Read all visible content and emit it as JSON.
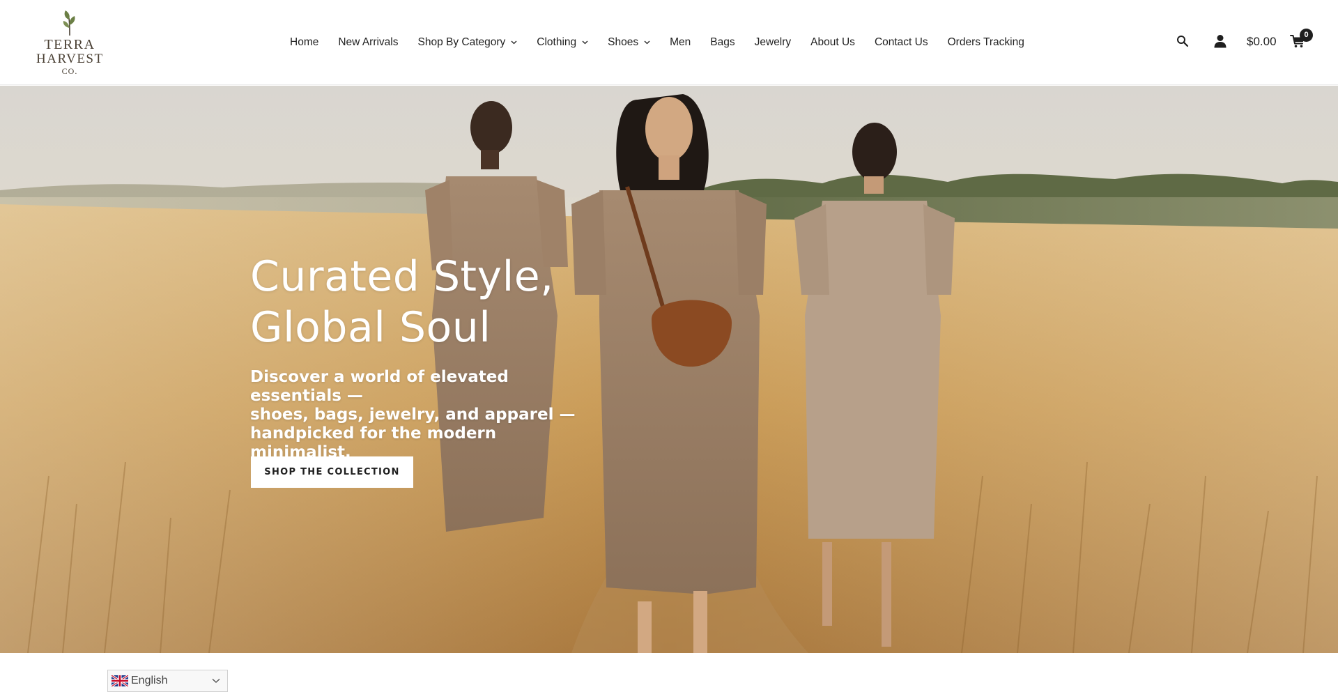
{
  "brand": {
    "logo_lines": [
      "TERRA",
      "HARVEST",
      "CO."
    ]
  },
  "nav": {
    "items": [
      {
        "label": "Home",
        "has_dropdown": false
      },
      {
        "label": "New Arrivals",
        "has_dropdown": false
      },
      {
        "label": "Shop By Category",
        "has_dropdown": true
      },
      {
        "label": "Clothing",
        "has_dropdown": true
      },
      {
        "label": "Shoes",
        "has_dropdown": true
      },
      {
        "label": "Men",
        "has_dropdown": false
      },
      {
        "label": "Bags",
        "has_dropdown": false
      },
      {
        "label": "Jewelry",
        "has_dropdown": false
      },
      {
        "label": "About Us",
        "has_dropdown": false
      },
      {
        "label": "Contact Us",
        "has_dropdown": false
      },
      {
        "label": "Orders Tracking",
        "has_dropdown": false
      }
    ]
  },
  "header_actions": {
    "search_icon": "search-icon",
    "account_icon": "user-icon",
    "cart_total": "$0.00",
    "cart_icon": "cart-icon",
    "cart_count": "0"
  },
  "hero": {
    "title_lines": [
      "Curated Style,",
      "Global Soul"
    ],
    "subtitle_lines": [
      "Discover a world of elevated essentials —",
      "shoes, bags, jewelry, and apparel —",
      "handpicked for the modern minimalist."
    ],
    "cta_label": "SHOP THE COLLECTION"
  },
  "language_selector": {
    "flag_icon": "uk-flag-icon",
    "selected": "English"
  },
  "colors": {
    "text": "#1f1f1f",
    "header_bg": "#ffffff",
    "logo": "#4a4034",
    "logo_leaf": "#6b7f45",
    "hero_text": "#ffffff",
    "cta_bg": "#ffffff",
    "field_gold": "#c79a52",
    "sky": "#ece6d8"
  }
}
